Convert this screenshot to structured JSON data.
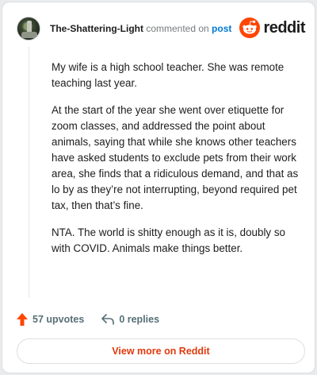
{
  "header": {
    "username": "The-Shattering-Light",
    "action_text": " commented on ",
    "post_link": "post",
    "brand_name": "reddit"
  },
  "comment": {
    "paragraphs": [
      "My wife is a high school teacher. She was remote teaching last year.",
      "At the start of the year she went over etiquette for zoom classes, and addressed the point about animals, saying that while she knows other teachers have asked students to exclude pets from their work area, she finds that a ridiculous demand, and that as lo by as they’re not interrupting, beyond required pet tax, then that’s fine.",
      "NTA. The world is shitty enough as it is, doubly so with COVID. Animals make things better."
    ]
  },
  "actions": {
    "upvotes": "57 upvotes",
    "replies": "0 replies",
    "upvote_icon": "upvote-arrow-icon",
    "reply_icon": "reply-arrow-icon"
  },
  "footer": {
    "view_more": "View more on Reddit"
  },
  "colors": {
    "brand_orange": "#ff4500",
    "upvote": "#ff4500",
    "link_blue": "#0079d3",
    "view_more_text": "#e03a0e"
  }
}
